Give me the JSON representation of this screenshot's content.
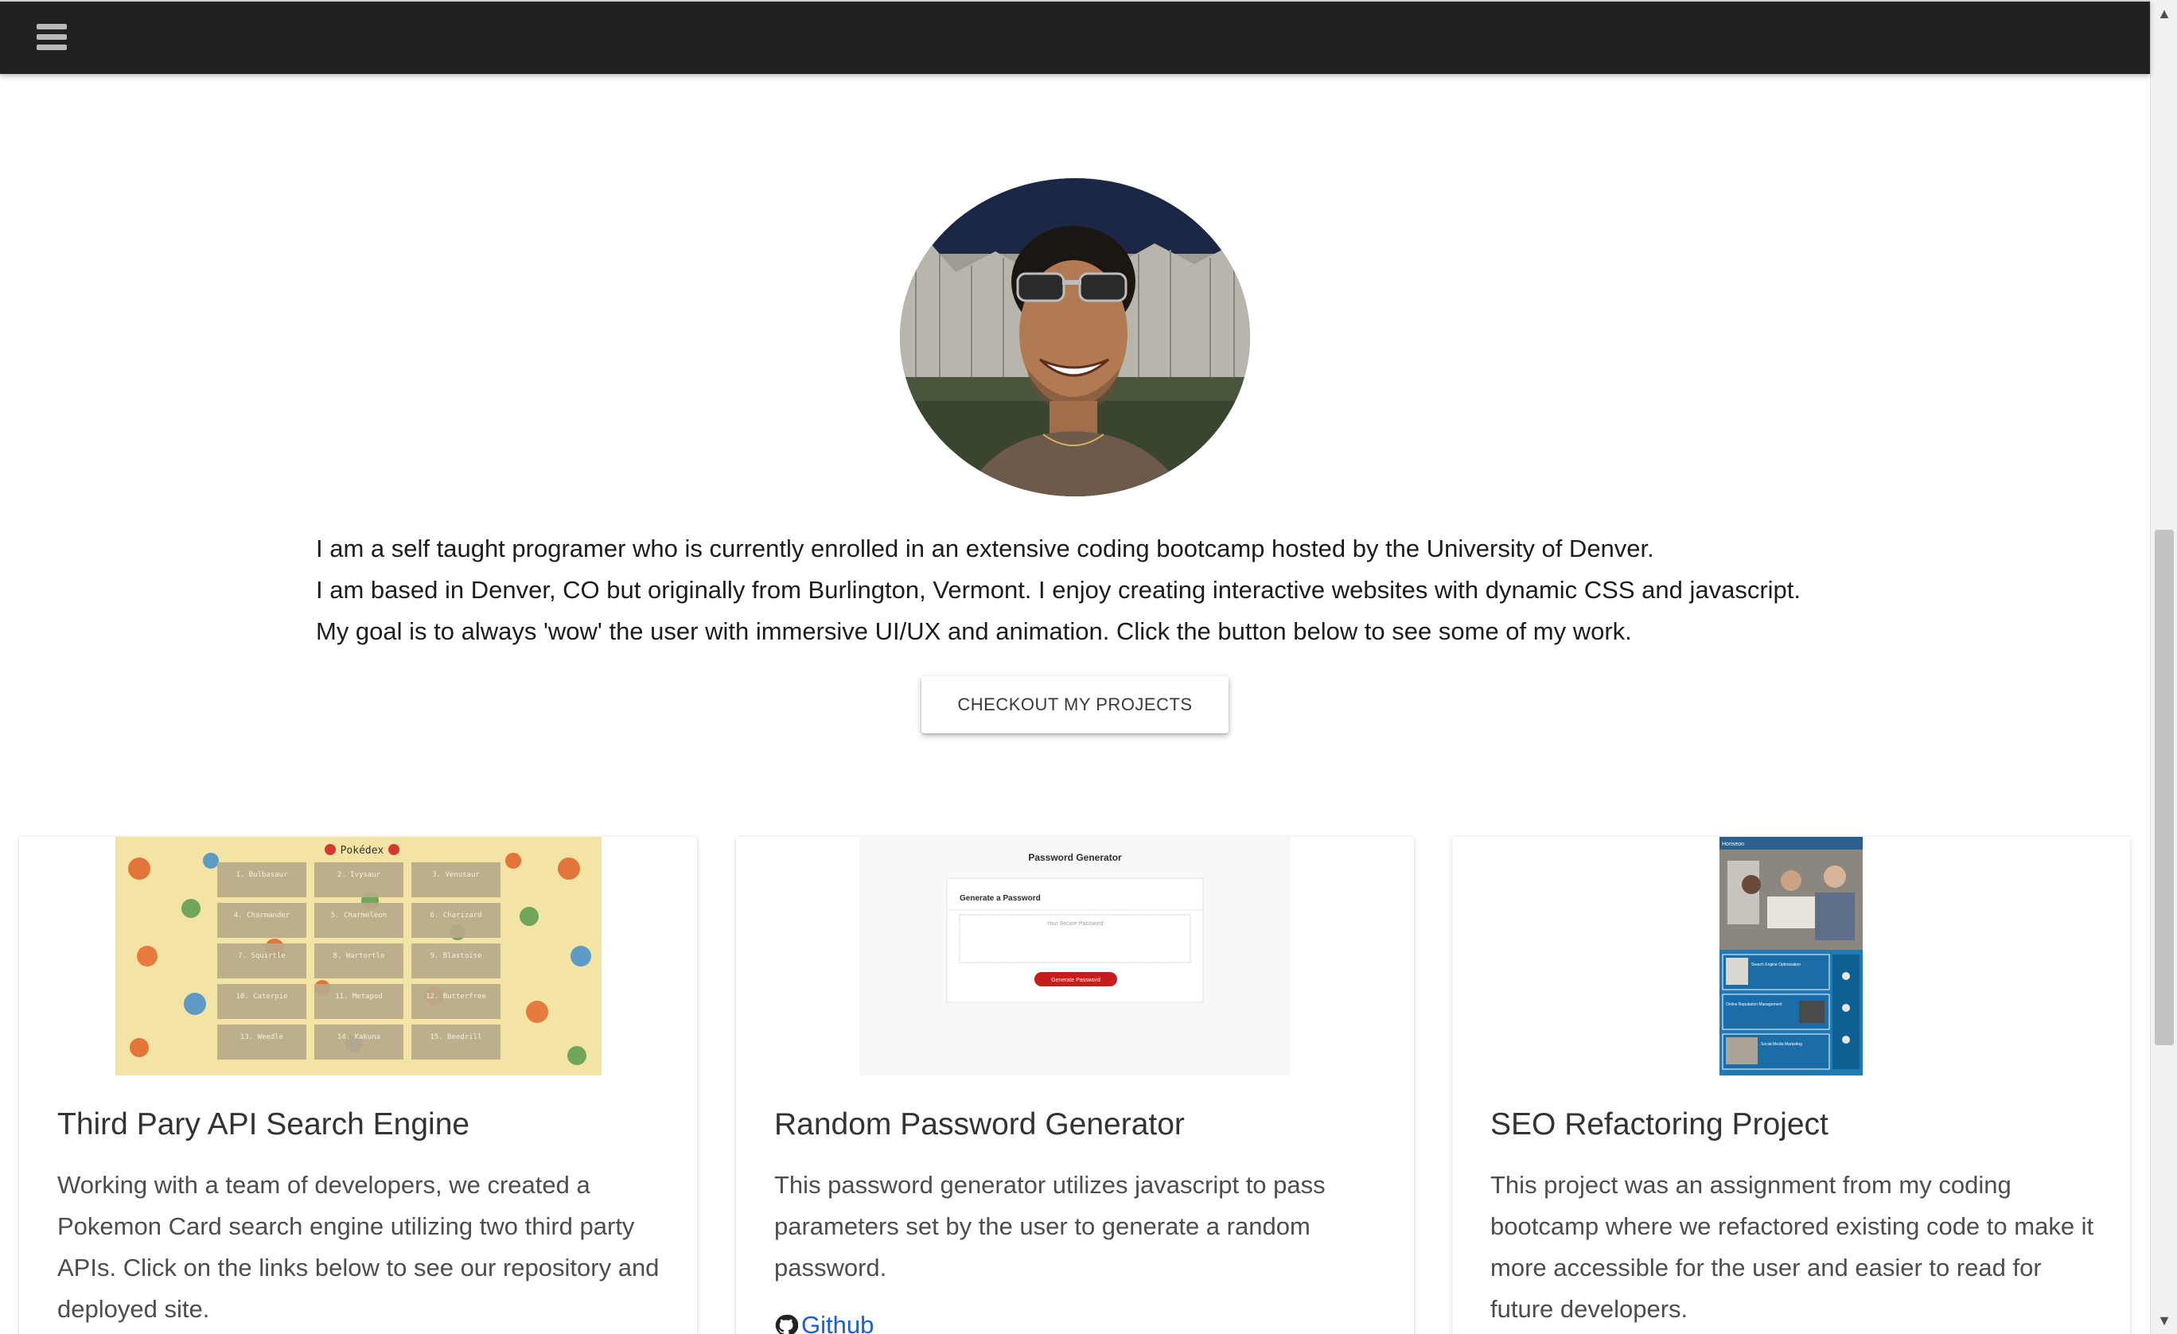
{
  "nav": {
    "menu_icon": "hamburger-menu-icon"
  },
  "profile": {
    "bio_lines": [
      "I am a self taught programer who is currently enrolled in an extensive coding bootcamp hosted by the University of Denver.",
      "I am based in Denver, CO but originally from Burlington, Vermont. I enjoy creating interactive websites with dynamic CSS and javascript.",
      "My goal is to always 'wow' the user with immersive UI/UX and animation. Click the button below to see some of my work."
    ],
    "cta_label": "CHECKOUT MY PROJECTS"
  },
  "projects": [
    {
      "title": "Third Pary API Search Engine",
      "description": "Working with a team of developers, we created a Pokemon Card search engine utilizing two third party APIs. Click on the links below to see our repository and deployed site.",
      "screenshot": {
        "header": "Pokédex",
        "cards": [
          "1. Bulbasaur",
          "2. Ivysaur",
          "3. Venusaur",
          "4. Charmander",
          "5. Charmeleon",
          "6. Charizard",
          "7. Squirtle",
          "8. Wartortle",
          "9. Blastoise",
          "10. Caterpie",
          "11. Metapod",
          "12. Butterfree",
          "13. Weedle",
          "14. Kakuna",
          "15. Beedrill"
        ]
      }
    },
    {
      "title": "Random Password Generator",
      "description": "This password generator utilizes javascript to pass parameters set by the user to generate a random password.",
      "link_label": "Github",
      "link_icon": "github-icon",
      "screenshot": {
        "heading": "Password Generator",
        "subheading": "Generate a Password",
        "placeholder": "Your Secure Password",
        "button": "Generate Password"
      }
    },
    {
      "title": "SEO Refactoring Project",
      "description": "This project was an assignment from my coding bootcamp where we refactored existing code to make it more accessible for the user and easier to read for future developers.",
      "screenshot": {
        "brand": "Horiseon",
        "sections": [
          "Search Engine Optimization",
          "Online Reputation Management",
          "Social Media Marketing"
        ]
      }
    }
  ],
  "colors": {
    "navbar": "#212121",
    "accent_button": "#c81d1d",
    "link": "#1a5fd6",
    "seo_blue": "#1f7ab8"
  }
}
